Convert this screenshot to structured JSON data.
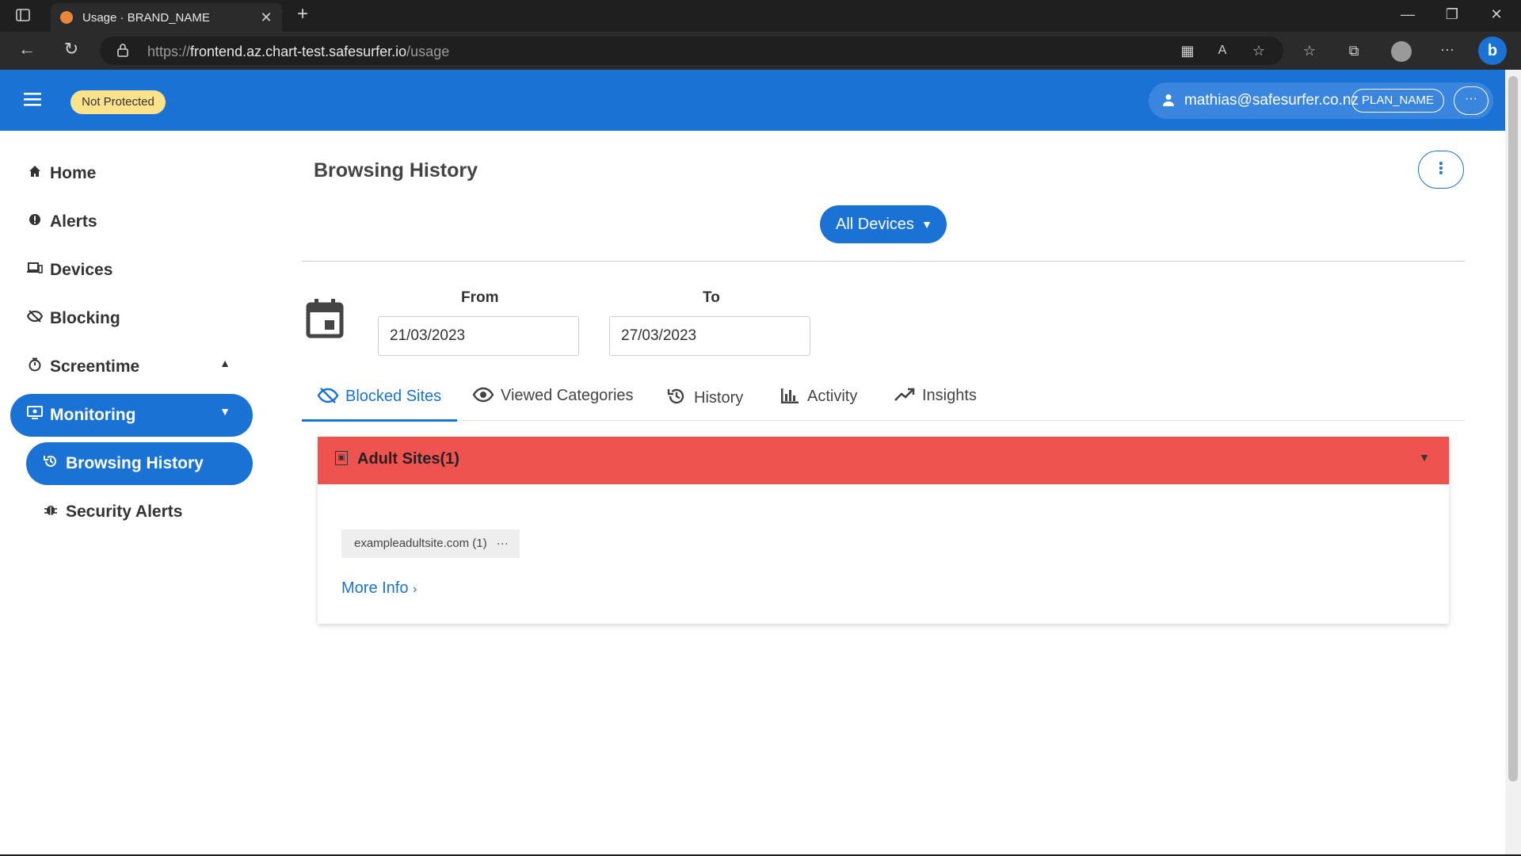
{
  "browser": {
    "tab_title": "Usage · BRAND_NAME",
    "url_scheme": "https://",
    "url_host": "frontend.az.chart-test.safesurfer.io",
    "url_path": "/usage"
  },
  "topbar": {
    "status_badge": "Not Protected",
    "user_email": "mathias@safesurfer.co.nz",
    "plan_name": "PLAN_NAME",
    "more_label": "···"
  },
  "sidebar": {
    "items": [
      {
        "label": "Home",
        "icon": "home-icon"
      },
      {
        "label": "Alerts",
        "icon": "alert-icon"
      },
      {
        "label": "Devices",
        "icon": "devices-icon"
      },
      {
        "label": "Blocking",
        "icon": "blocking-icon"
      },
      {
        "label": "Screentime",
        "icon": "timer-icon"
      },
      {
        "label": "Monitoring",
        "icon": "monitor-icon"
      },
      {
        "label": "Browsing History",
        "icon": "history-icon"
      },
      {
        "label": "Security Alerts",
        "icon": "bug-icon"
      }
    ]
  },
  "main": {
    "title": "Browsing History",
    "devices_button": "All Devices",
    "from_label": "From",
    "to_label": "To",
    "from_value": "21/03/2023",
    "to_value": "27/03/2023",
    "tabs": [
      {
        "label": "Blocked Sites",
        "icon": "eye-off-icon"
      },
      {
        "label": "Viewed Categories",
        "icon": "eye-icon"
      },
      {
        "label": "History",
        "icon": "history-icon"
      },
      {
        "label": "Activity",
        "icon": "bar-chart-icon"
      },
      {
        "label": "Insights",
        "icon": "trend-icon"
      }
    ],
    "category_card": {
      "title": "Adult Sites(1)",
      "site_chip": "exampleadultsite.com (1)",
      "chip_more": "···",
      "more_info": "More Info"
    }
  },
  "colors": {
    "accent": "#1a73d4",
    "status_badge": "#fbe28b",
    "category_header": "#ef5350"
  }
}
